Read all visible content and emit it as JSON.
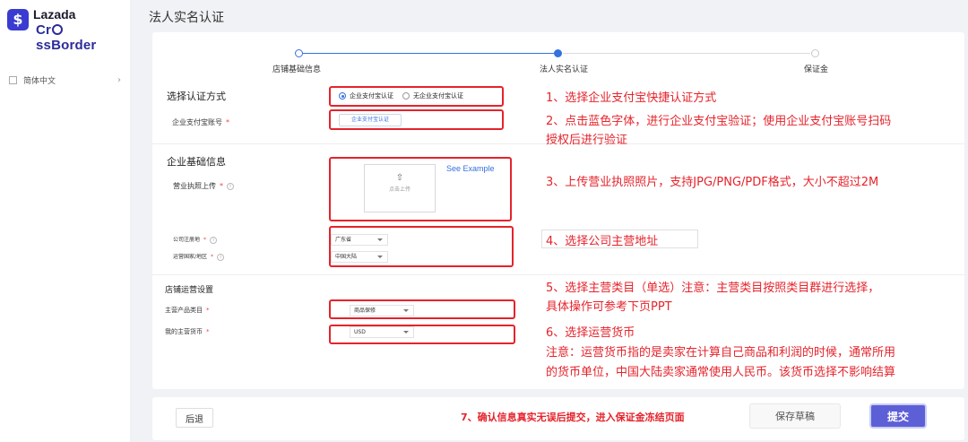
{
  "sidebar": {
    "logo_brand": "Lazada",
    "logo_sub": "Cr∅ssBorder",
    "logo_badge": "$",
    "lang_item": "简体中文",
    "chevron": "›"
  },
  "page_title": "法人实名认证",
  "stepper": {
    "steps": [
      {
        "label": "店铺基础信息",
        "state": "done"
      },
      {
        "label": "法人实名认证",
        "state": "current"
      },
      {
        "label": "保证金",
        "state": "pending"
      }
    ]
  },
  "auth": {
    "section_title": "选择认证方式",
    "options": [
      "企业支付宝认证",
      "无企业支付宝认证"
    ],
    "selected": 0,
    "account_label": "企业支付宝账号",
    "account_button": "企业支付宝认证"
  },
  "company": {
    "section_title": "企业基础信息",
    "license_label": "营业执照上传",
    "upload_text": "点击上传",
    "see_example": "See Example",
    "reg_place_label": "公司注册地",
    "reg_place_value": "广东省",
    "op_region_label": "运营国家/地区",
    "op_region_value": "中国大陆"
  },
  "store": {
    "section_title": "店铺运营设置",
    "category_label": "主营产品类目",
    "category_value": "商品保修",
    "currency_label": "我的主营货币",
    "currency_value": "USD"
  },
  "annotations": {
    "a1": "1、选择企业支付宝快捷认证方式",
    "a2_line1": "2、点击蓝色字体，进行企业支付宝验证；使用企业支付宝账号扫码",
    "a2_line2": "授权后进行验证",
    "a3": "3、上传营业执照照片，支持JPG/PNG/PDF格式，大小不超过2M",
    "a4": "4、选择公司主营地址",
    "a5_line1": "5、选择主营类目（单选）注意：主营类目按照类目群进行选择，",
    "a5_line2": "具体操作可参考下页PPT",
    "a6_line1": "6、选择运营货币",
    "a6_line2": "注意：运营货币指的是卖家在计算自己商品和利润的时候，通常所用",
    "a6_line3": "的货币单位，中国大陆卖家通常使用人民币。该货币选择不影响结算",
    "a7": "7、确认信息真实无误后提交，进入保证金冻结页面"
  },
  "footer": {
    "back": "后退",
    "save_draft": "保存草稿",
    "submit": "提交"
  },
  "colors": {
    "accent": "#3471e0",
    "annotation_red": "#e5232b",
    "submit_bg": "#5d5fd6"
  }
}
